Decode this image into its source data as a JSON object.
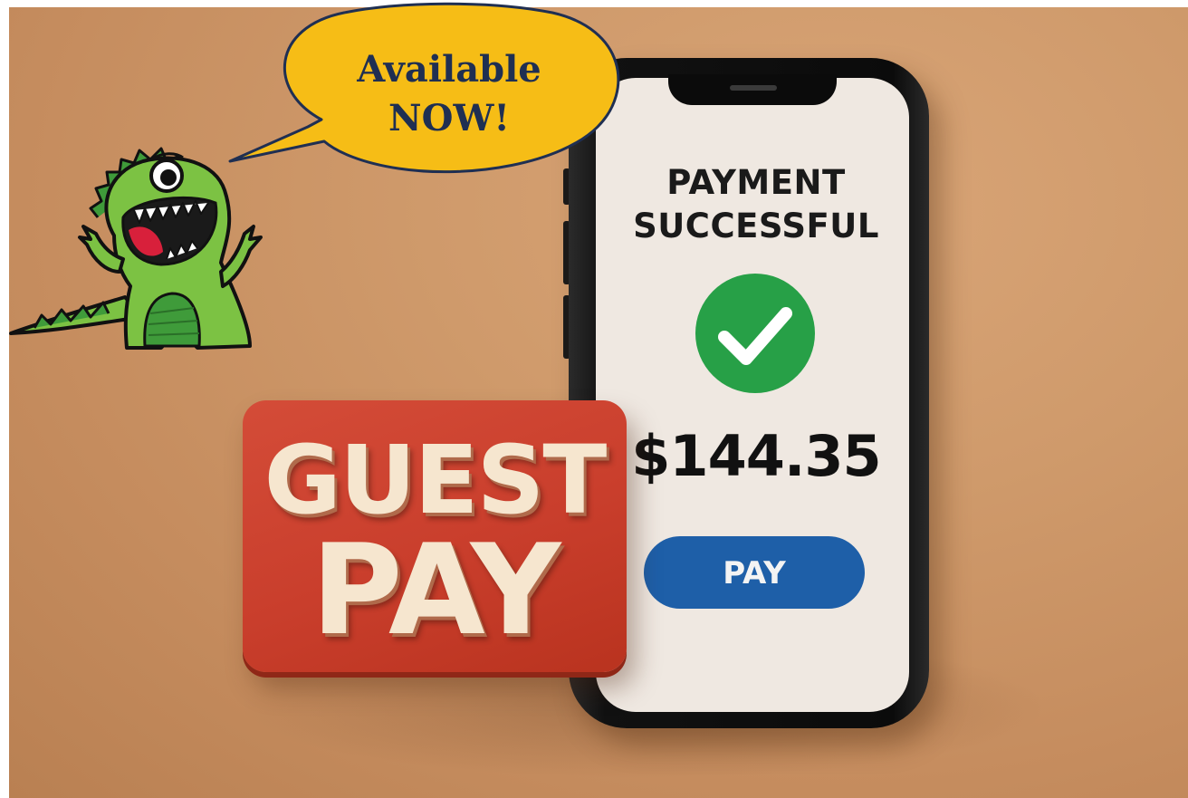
{
  "bubble": {
    "line1": "Available",
    "line2": "NOW!"
  },
  "phone": {
    "status_line1": "PAYMENT",
    "status_line2": "SUCCESSFUL",
    "amount": "$144.35",
    "pay_button_label": "PAY"
  },
  "sign": {
    "line1": "GUEST",
    "line2": "PAY"
  },
  "icons": {
    "success": "checkmark-icon",
    "mascot": "dinosaur-mascot"
  },
  "colors": {
    "background": "#cf9a6b",
    "sign_red": "#c93e2c",
    "sign_text": "#f6e6cf",
    "bubble_fill": "#f6bd16",
    "bubble_text": "#1f2f52",
    "success_green": "#27a047",
    "pay_button_blue": "#1e5fa8",
    "dino_green": "#7cc243"
  }
}
